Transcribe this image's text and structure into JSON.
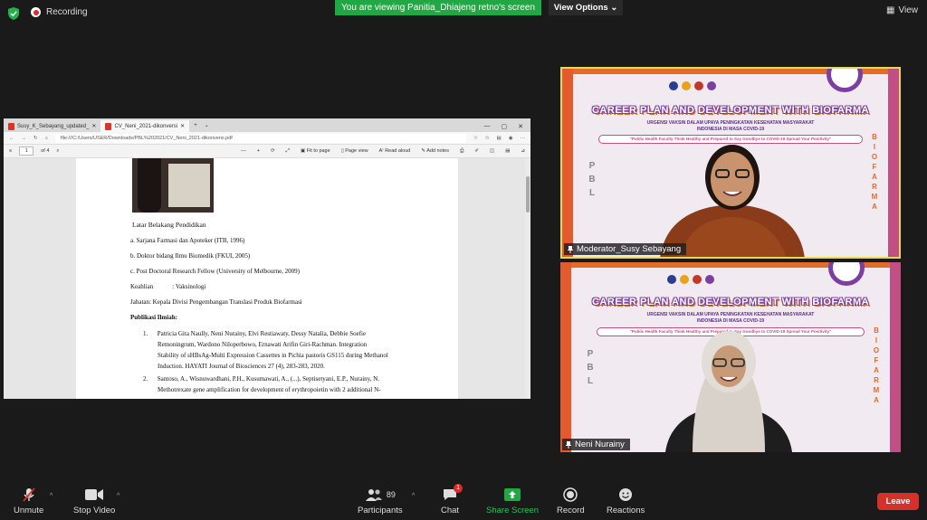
{
  "top": {
    "recording_label": "Recording",
    "banner_text": "You are viewing Panitia_Dhiajeng retno's screen",
    "view_options": "View Options",
    "view_label": "View"
  },
  "browser": {
    "tabs": [
      "Susy_K_Sebayang_updated_",
      "CV_Neni_2021-dikonversi"
    ],
    "url": "file:///C:/Users/USER/Downloads/PBL%202021/CV_Neni_2021-dikonversi.pdf",
    "page_num": "1",
    "page_total": "of 4",
    "fit_to_page": "Fit to page",
    "page_view": "Page view",
    "read_aloud": "Read aloud",
    "add_notes": "Add notes"
  },
  "document": {
    "lines": [
      "Latar Belakang Pendidikan",
      "a. Sarjana Farmasi dan Apoteker (ITB, 1996)",
      "b. Doktor bidang Ilmu Biomedik (FKUI, 2005)",
      "c. Post Doctoral Research Fellow (University of Melbourne, 2009)",
      "Keahlian            : Vaksinologi",
      "Jabatan: Kepala Divisi Pengembangan Translasi Produk Biofarmasi",
      "Publikasi Ilmiah:",
      "1.      Patricia Gita Naully, Neni Nurainy, Elvi Restiawaty, Dessy Natalia, Debbie Soefie",
      "Retnoningrum, Wardono Niloperbowo, Ernawati Arifin Giri-Rachman. Integration",
      "Stability of sHBsAg-Multi Expression Cassettes in Pichia pastoris GS115 during Methanol",
      "Induction. HAYATI Journal of Biosciences 27 (4), 283-283, 2020.",
      "2.      Santoso, A., Wisnuwardhani, P.H., Kusumawati, A., (...), Septisetyani, E.P., Nurainy, N.",
      "Methotrexate gene amplification for development of erythropoietin with 2 additional N-"
    ]
  },
  "tiles": [
    {
      "name_label": "Moderator_Susy Sebayang",
      "headline": "CAREER PLAN AND DEVELOPMENT WITH BIOFARMA",
      "sub1": "URGENSI VAKSIN DALAM UPAYA PENINGKATAN KESEHATAN MASYARAKAT",
      "sub2": "INDONESIA DI MASA COVID-19",
      "pill": "\"Public Health Faculty Think Healthy and Prepared to Say Goodbye to COVID-19 Spread Your Positivity\"",
      "pbl": [
        "P",
        "B",
        "L"
      ],
      "bio": [
        "B",
        "I",
        "O",
        "F",
        "A",
        "R",
        "M",
        "A"
      ]
    },
    {
      "name_label": "Neni Nurainy",
      "headline": "CAREER PLAN AND DEVELOPMENT WITH BIOFARMA",
      "sub1": "URGENSI VAKSIN DALAM UPAYA PENINGKATAN KESEHATAN MASYARAKAT",
      "sub2": "INDONESIA DI MASA COVID-19",
      "pill": "\"Public Health Faculty Think Healthy and Prepared to Say Goodbye to COVID-19 Spread Your Positivity\"",
      "pbl": [
        "P",
        "B",
        "L"
      ],
      "bio": [
        "B",
        "I",
        "O",
        "F",
        "A",
        "R",
        "M",
        "A"
      ]
    }
  ],
  "toolbar": {
    "unmute": "Unmute",
    "stop_video": "Stop Video",
    "participants": "Participants",
    "participants_count": "89",
    "chat": "Chat",
    "chat_badge": "1",
    "share_screen": "Share Screen",
    "record": "Record",
    "reactions": "Reactions",
    "leave": "Leave"
  },
  "colors": {
    "share_green": "#22a745",
    "leave_red": "#d3312a",
    "active_speaker": "#e6d85a"
  }
}
